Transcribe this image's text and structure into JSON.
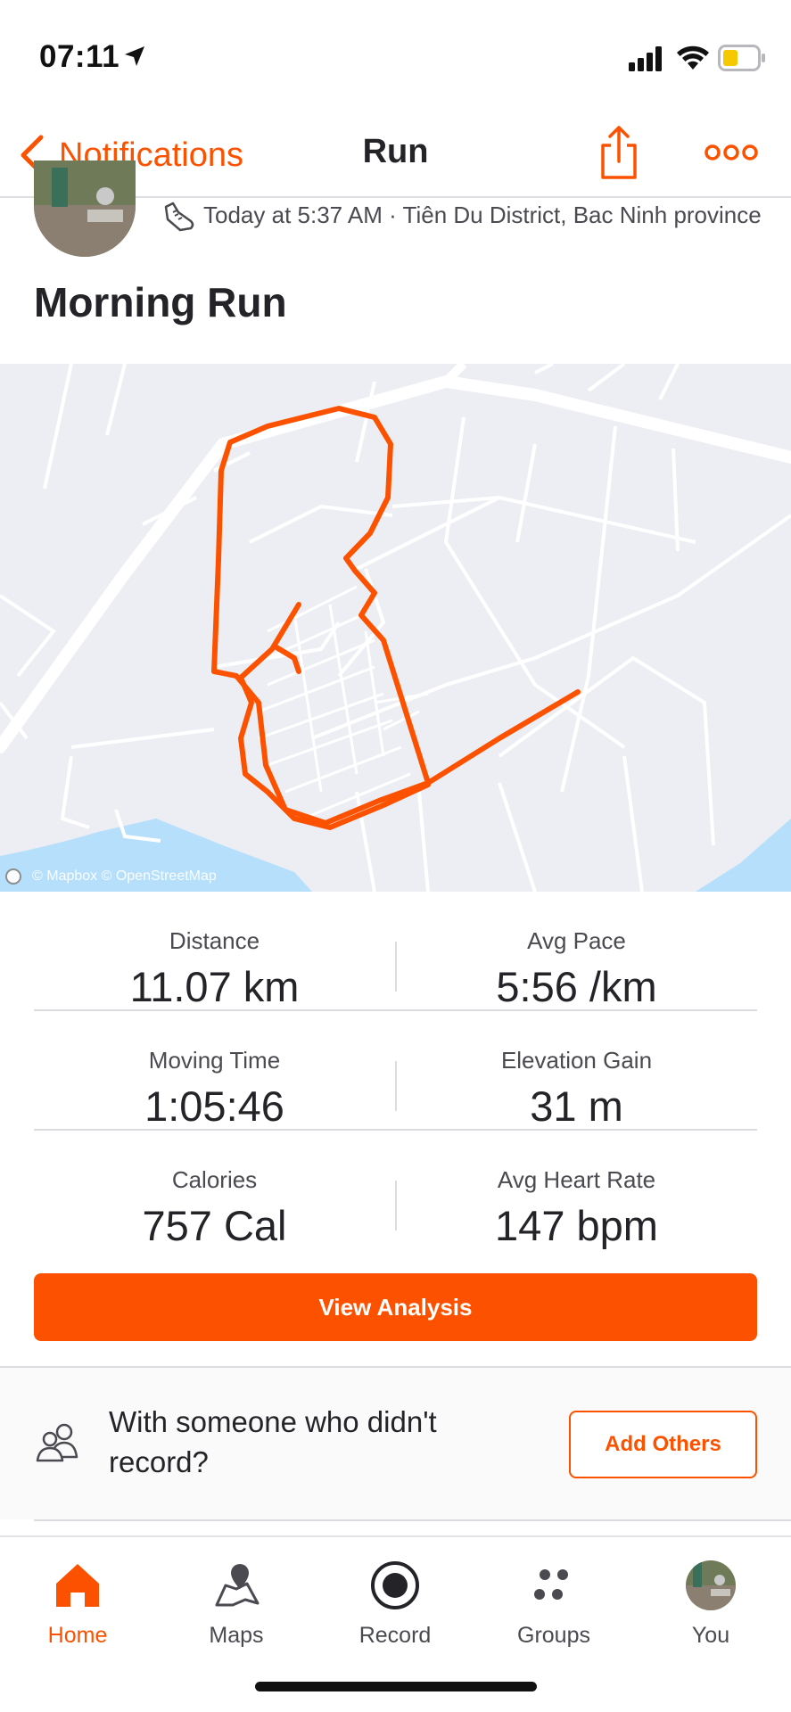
{
  "status_bar": {
    "time": "07:11"
  },
  "nav": {
    "back_label": "Notifications",
    "title": "Run"
  },
  "activity": {
    "meta": "Today at 5:37 AM · Tiên Du District, Bac Ninh province",
    "title": "Morning Run"
  },
  "map": {
    "attribution": "© Mapbox © OpenStreetMap"
  },
  "stats": {
    "distance": {
      "label": "Distance",
      "value": "11.07 km"
    },
    "avg_pace": {
      "label": "Avg Pace",
      "value": "5:56 /km"
    },
    "moving_time": {
      "label": "Moving Time",
      "value": "1:05:46"
    },
    "elevation_gain": {
      "label": "Elevation Gain",
      "value": "31 m"
    },
    "calories": {
      "label": "Calories",
      "value": "757 Cal"
    },
    "avg_heart_rate": {
      "label": "Avg Heart Rate",
      "value": "147 bpm"
    }
  },
  "actions": {
    "view_analysis": "View Analysis",
    "with_others_text": "With someone who didn't record?",
    "add_others": "Add Others"
  },
  "tabs": [
    {
      "label": "Home",
      "icon": "home-icon",
      "active": true
    },
    {
      "label": "Maps",
      "icon": "map-icon",
      "active": false
    },
    {
      "label": "Record",
      "icon": "record-icon",
      "active": false
    },
    {
      "label": "Groups",
      "icon": "groups-icon",
      "active": false
    },
    {
      "label": "You",
      "icon": "avatar",
      "active": false
    }
  ],
  "colors": {
    "accent": "#fc5200",
    "text": "#242428",
    "map_bg": "#edeef3",
    "water": "#b6dffc"
  }
}
